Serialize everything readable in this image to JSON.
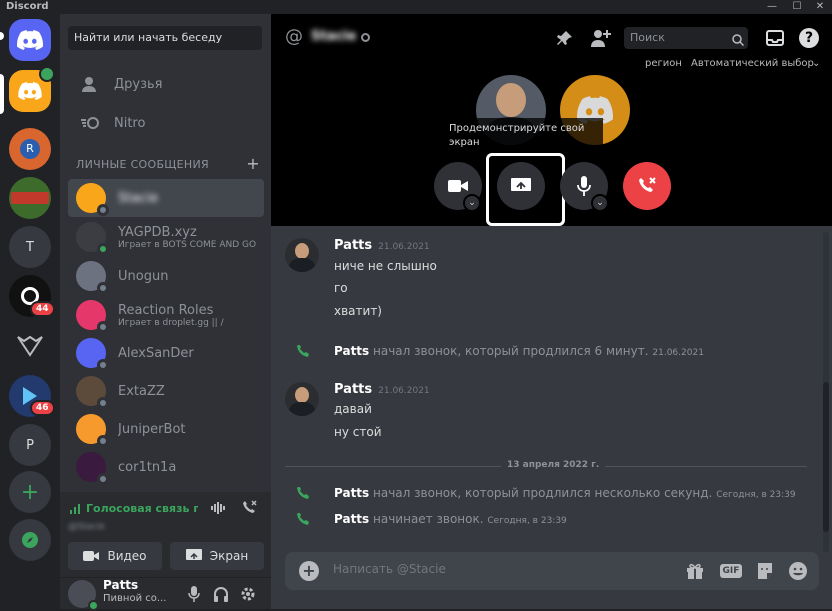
{
  "window": {
    "title": "Discord",
    "minimize": "—",
    "maximize": "☐",
    "close": "✕"
  },
  "colors": {
    "brand": "#5865f2",
    "online": "#3ba55d",
    "danger": "#ed4245",
    "bg": "#36393f",
    "sidebar": "#2f3136",
    "rail": "#202225"
  },
  "servers": {
    "badges": [
      "44",
      "46"
    ],
    "letters": [
      "T",
      "P"
    ]
  },
  "sidebar": {
    "search_placeholder": "Найти или начать беседу",
    "nav": [
      {
        "label": "Друзья",
        "icon": "friends-icon"
      },
      {
        "label": "Nitro",
        "icon": "nitro-icon"
      }
    ],
    "dm_header": "ЛИЧНЫЕ СООБЩЕНИЯ",
    "dm_add": "+",
    "dms": [
      {
        "name": "Stacie",
        "sub": "",
        "status": "offline",
        "avatar_color": "#faa61a",
        "active": true
      },
      {
        "name": "YAGPDB.xyz",
        "sub": "Играет в BOTS COME AND GO",
        "status": "online",
        "avatar_color": "#3b3d42"
      },
      {
        "name": "Unogun",
        "sub": "",
        "status": "offline",
        "avatar_color": "#6c7280"
      },
      {
        "name": "Reaction Roles",
        "sub": "Играет в droplet.gg || /",
        "status": "offline",
        "avatar_color": "#e5376a"
      },
      {
        "name": "AlexSanDer",
        "sub": "",
        "status": "offline",
        "avatar_color": "#5865f2"
      },
      {
        "name": "ExtaZZ",
        "sub": "",
        "status": "offline",
        "avatar_color": "#5c4a3a"
      },
      {
        "name": "JuniperBot",
        "sub": "",
        "status": "offline",
        "avatar_color": "#f79a2d"
      },
      {
        "name": "cor1tn1a",
        "sub": "",
        "status": "offline",
        "avatar_color": "#3a1a3f"
      }
    ]
  },
  "voice": {
    "status": "Голосовая связь подключена",
    "sub": "@Stacie",
    "video_label": "Видео",
    "screen_label": "Экран"
  },
  "user": {
    "name": "Patts",
    "status": "Пивной со..."
  },
  "header": {
    "recipient": "Stacie",
    "search_placeholder": "Поиск",
    "region_label": "регион",
    "region_value": "Автоматический выбор"
  },
  "call": {
    "tooltip": "Продемонстрируйте свой экран"
  },
  "messages": [
    {
      "author": "Patts",
      "time": "21.06.2021",
      "lines": [
        "ниче не слышно",
        "го",
        "хватит)"
      ]
    },
    {
      "system": true,
      "author": "Patts",
      "text": "начал звонок, который продлился 6 минут.",
      "time": "21.06.2021"
    },
    {
      "author": "Patts",
      "time": "21.06.2021",
      "lines": [
        "давай",
        "ну стой"
      ]
    },
    {
      "divider": "13 апреля 2022 г."
    },
    {
      "system": true,
      "author": "Patts",
      "text": "начал звонок, который продлился несколько секунд.",
      "time": "Сегодня, в 23:39"
    },
    {
      "system": true,
      "author": "Patts",
      "text": "начинает звонок.",
      "time": "Сегодня, в 23:39"
    }
  ],
  "composer": {
    "placeholder": "Написать @Stacie",
    "gif": "GIF"
  }
}
